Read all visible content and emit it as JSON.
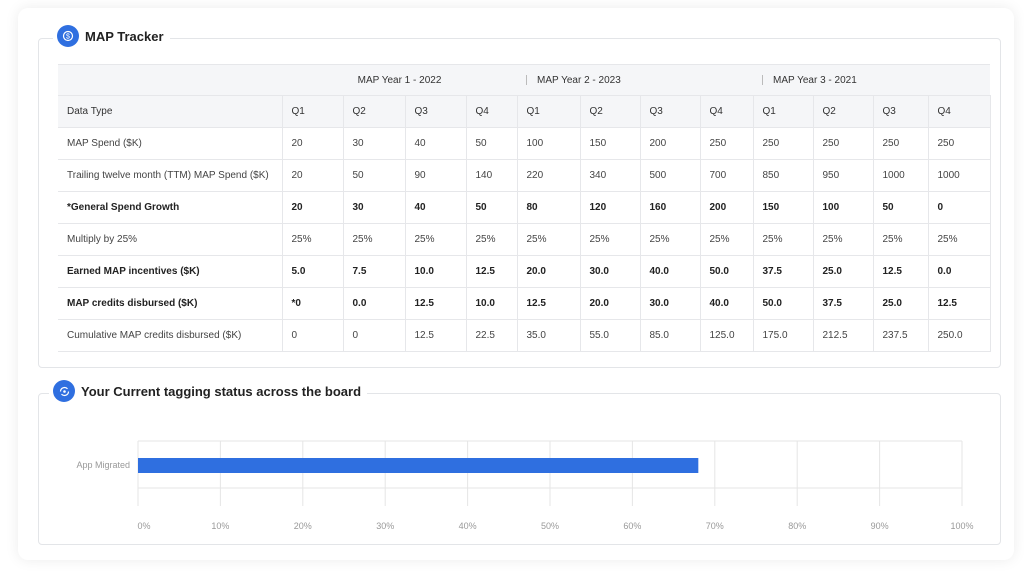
{
  "tracker": {
    "title": "MAP Tracker",
    "icon": "dollar-circle-icon",
    "years": [
      "MAP Year 1 - 2022",
      "MAP Year 2 - 2023",
      "MAP Year 3 - 2021"
    ],
    "header_label": "Data Type",
    "quarters": [
      "Q1",
      "Q2",
      "Q3",
      "Q4",
      "Q1",
      "Q2",
      "Q3",
      "Q4",
      "Q1",
      "Q2",
      "Q3",
      "Q4"
    ],
    "rows": [
      {
        "label": "MAP Spend ($K)",
        "bold": false,
        "values": [
          "20",
          "30",
          "40",
          "50",
          "100",
          "150",
          "200",
          "250",
          "250",
          "250",
          "250",
          "250"
        ]
      },
      {
        "label": "Trailing twelve month (TTM) MAP Spend ($K)",
        "bold": false,
        "values": [
          "20",
          "50",
          "90",
          "140",
          "220",
          "340",
          "500",
          "700",
          "850",
          "950",
          "1000",
          "1000"
        ]
      },
      {
        "label": "*General Spend Growth",
        "bold": true,
        "values": [
          "20",
          "30",
          "40",
          "50",
          "80",
          "120",
          "160",
          "200",
          "150",
          "100",
          "50",
          "0"
        ]
      },
      {
        "label": "Multiply by 25%",
        "bold": false,
        "values": [
          "25%",
          "25%",
          "25%",
          "25%",
          "25%",
          "25%",
          "25%",
          "25%",
          "25%",
          "25%",
          "25%",
          "25%"
        ]
      },
      {
        "label": "Earned MAP incentives ($K)",
        "bold": true,
        "values": [
          "5.0",
          "7.5",
          "10.0",
          "12.5",
          "20.0",
          "30.0",
          "40.0",
          "50.0",
          "37.5",
          "25.0",
          "12.5",
          "0.0"
        ]
      },
      {
        "label": "MAP credits disbursed ($K)",
        "bold": true,
        "values": [
          "*0",
          "0.0",
          "12.5",
          "10.0",
          "12.5",
          "20.0",
          "30.0",
          "40.0",
          "50.0",
          "37.5",
          "25.0",
          "12.5"
        ]
      },
      {
        "label": "Cumulative MAP credits disbursed ($K)",
        "bold": false,
        "values": [
          "0",
          "0",
          "12.5",
          "22.5",
          "35.0",
          "55.0",
          "85.0",
          "125.0",
          "175.0",
          "212.5",
          "237.5",
          "250.0"
        ]
      }
    ]
  },
  "tagging": {
    "title": "Your Current tagging status across the board",
    "icon": "tag-refresh-icon"
  },
  "chart_data": {
    "type": "bar",
    "orientation": "horizontal",
    "categories": [
      "App Migrated"
    ],
    "values": [
      68
    ],
    "xlim": [
      0,
      100
    ],
    "xticks": [
      "0%",
      "10%",
      "20%",
      "30%",
      "40%",
      "50%",
      "60%",
      "70%",
      "80%",
      "90%",
      "100%"
    ],
    "grid": true,
    "color": "#2f6fe0"
  }
}
